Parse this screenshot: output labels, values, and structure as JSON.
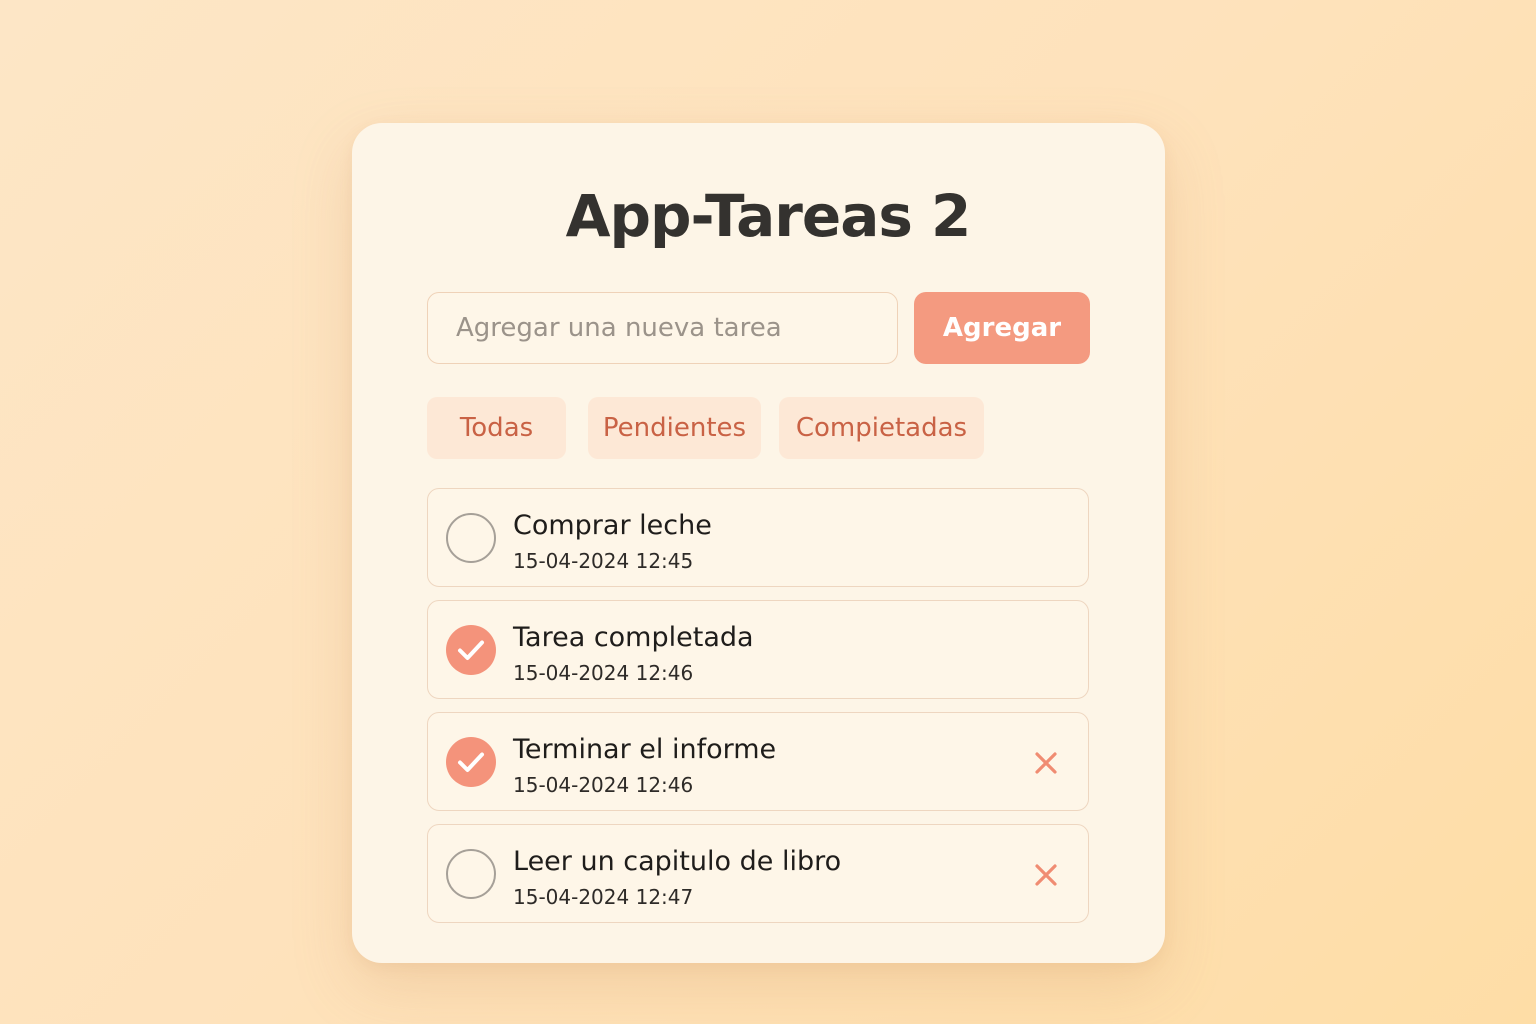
{
  "app": {
    "title": "App-Tareas 2"
  },
  "input": {
    "placeholder": "Agregar una nueva tarea",
    "value": ""
  },
  "add_button": {
    "label": "Agregar"
  },
  "filters": [
    {
      "label": "Todas"
    },
    {
      "label": "Pendientes"
    },
    {
      "label": "Compietadas"
    }
  ],
  "tasks": [
    {
      "title": "Comprar leche",
      "date": "15-04-2024 12:45",
      "completed": false,
      "has_delete": false
    },
    {
      "title": "Tarea completada",
      "date": "15-04-2024 12:46",
      "completed": true,
      "has_delete": false
    },
    {
      "title": "Terminar el informe",
      "date": "15-04-2024 12:46",
      "completed": true,
      "has_delete": true
    },
    {
      "title": "Leer un capitulo de libro",
      "date": "15-04-2024 12:47",
      "completed": false,
      "has_delete": true
    }
  ],
  "icons": {
    "check": "check-icon",
    "delete": "close-icon"
  },
  "colors": {
    "accent": "#f49a80",
    "filter_bg": "#fde8d6",
    "filter_text": "#c96245",
    "card_bg": "#fdf5e7",
    "title": "#34322f"
  }
}
